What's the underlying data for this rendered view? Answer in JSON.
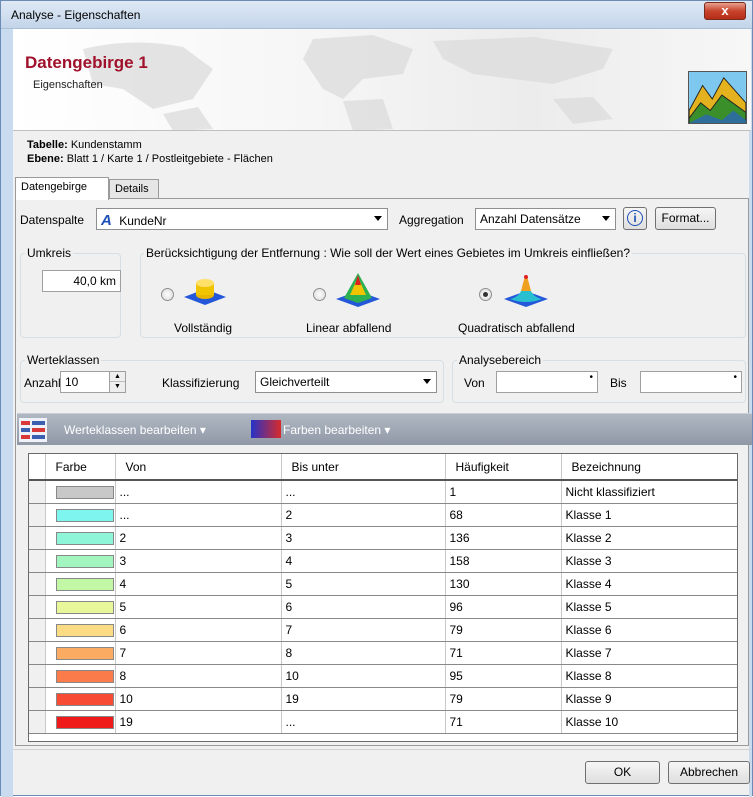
{
  "window": {
    "title": "Analyse - Eigenschaften",
    "close": "x"
  },
  "header": {
    "title": "Datengebirge 1",
    "subtitle": "Eigenschaften"
  },
  "info": {
    "table_label": "Tabelle:",
    "table_value": "Kundenstamm",
    "layer_label": "Ebene:",
    "layer_value": "Blatt 1 / Karte 1 / Postleitgebiete - Flächen"
  },
  "tabs": [
    {
      "label": "Datengebirge"
    },
    {
      "label": "Details"
    }
  ],
  "settings": {
    "data_column_label": "Datenspalte",
    "data_column_value": "KundeNr",
    "aggregation_label": "Aggregation",
    "aggregation_value": "Anzahl Datensätze",
    "info_glyph": "i",
    "format_button": "Format..."
  },
  "radius": {
    "label": "Umkreis",
    "value": "40,0 km"
  },
  "distance": {
    "label": "Berücksichtigung der Entfernung : Wie soll der Wert eines Gebietes im Umkreis einfließen?",
    "options": [
      {
        "label": "Vollständig",
        "selected": false
      },
      {
        "label": "Linear abfallend",
        "selected": false
      },
      {
        "label": "Quadratisch abfallend",
        "selected": true
      }
    ]
  },
  "value_classes": {
    "label": "Werteklassen",
    "count_label": "Anzahl",
    "count_value": "10",
    "classification_label": "Klassifizierung",
    "classification_value": "Gleichverteilt"
  },
  "analysis_range": {
    "label": "Analysebereich",
    "from_label": "Von",
    "to_label": "Bis",
    "from_value": "",
    "to_value": ""
  },
  "toolbar": {
    "edit_classes": "Werteklassen bearbeiten",
    "edit_colors": "Farben bearbeiten",
    "dropdown_glyph": "▾"
  },
  "table": {
    "headers": [
      "Farbe",
      "Von",
      "Bis unter",
      "Häufigkeit",
      "Bezeichnung"
    ],
    "rows": [
      {
        "color": "#c8c8c8",
        "from": "...",
        "to": "...",
        "count": "1",
        "name": "Nicht klassifiziert"
      },
      {
        "color": "#7ff5f0",
        "from": "...",
        "to": "2",
        "count": "68",
        "name": "Klasse 1"
      },
      {
        "color": "#8ff5d8",
        "from": "2",
        "to": "3",
        "count": "136",
        "name": "Klasse 2"
      },
      {
        "color": "#a3f5c0",
        "from": "3",
        "to": "4",
        "count": "158",
        "name": "Klasse 3"
      },
      {
        "color": "#c2f7a6",
        "from": "4",
        "to": "5",
        "count": "130",
        "name": "Klasse 4"
      },
      {
        "color": "#e8f79a",
        "from": "5",
        "to": "6",
        "count": "96",
        "name": "Klasse 5"
      },
      {
        "color": "#fbdc84",
        "from": "6",
        "to": "7",
        "count": "79",
        "name": "Klasse 6"
      },
      {
        "color": "#fbab62",
        "from": "7",
        "to": "8",
        "count": "71",
        "name": "Klasse 7"
      },
      {
        "color": "#fb7b4a",
        "from": "8",
        "to": "10",
        "count": "95",
        "name": "Klasse 8"
      },
      {
        "color": "#f74b33",
        "from": "10",
        "to": "19",
        "count": "79",
        "name": "Klasse 9"
      },
      {
        "color": "#ef1b1b",
        "from": "19",
        "to": "...",
        "count": "71",
        "name": "Klasse 10"
      }
    ]
  },
  "footer": {
    "ok": "OK",
    "cancel": "Abbrechen"
  }
}
